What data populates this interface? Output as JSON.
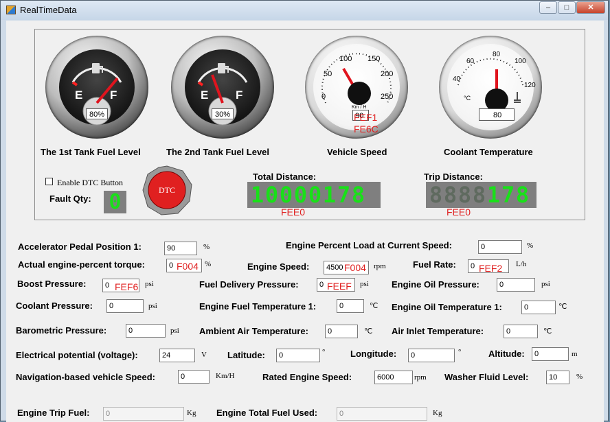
{
  "window": {
    "title": "RealTimeData"
  },
  "caption": {
    "minimize": "‒",
    "maximize": "□",
    "close": "✕"
  },
  "gauges": {
    "tank1": {
      "label": "The 1st Tank Fuel Level",
      "value": "80%",
      "level": 0.8,
      "e": "E",
      "f": "F"
    },
    "tank2": {
      "label": "The 2nd Tank Fuel Level",
      "value": "30%",
      "level": 0.3,
      "e": "E",
      "f": "F"
    },
    "speed": {
      "label": "Vehicle Speed",
      "value": "90",
      "unit": "Km / H",
      "pgn1": "FEF1",
      "pgn2": "FE6C",
      "ticks": [
        "0",
        "50",
        "100",
        "150",
        "200",
        "250"
      ]
    },
    "coolant": {
      "label": "Coolant Temperature",
      "value": "80",
      "unit": "°C",
      "ticks": [
        "40",
        "60",
        "80",
        "100",
        "120"
      ]
    }
  },
  "dtc": {
    "checkbox_label": "Enable DTC Button",
    "fault_label": "Fault Qty:",
    "fault_value": "0",
    "button_label": "DTC"
  },
  "total_distance": {
    "label": "Total Distance:",
    "digits": [
      "1",
      "0",
      "0",
      "0",
      "0",
      "1",
      "7",
      "8"
    ],
    "lit": 8,
    "pgn": "FEE0"
  },
  "trip_distance": {
    "label": "Trip Distance:",
    "digits": [
      "8",
      "8",
      "8",
      "8",
      "1",
      "7",
      "8"
    ],
    "lit": 3,
    "pgn": "FEE0"
  },
  "fields": {
    "accel": {
      "label": "Accelerator Pedal Position 1:",
      "value": "90",
      "unit": "%"
    },
    "load": {
      "label": "Engine Percent Load at Current Speed:",
      "value": "0",
      "unit": "%"
    },
    "torque": {
      "label": "Actual engine-percent torque:",
      "value": "0",
      "pgn": "F004",
      "unit": "%"
    },
    "enginespeed": {
      "label": "Engine Speed:",
      "value": "4500",
      "pgn": "F004",
      "unit": "rpm"
    },
    "fuelrate": {
      "label": "Fuel Rate:",
      "value": "0",
      "pgn": "FEF2",
      "unit": "L/h"
    },
    "boost": {
      "label": "Boost Pressure:",
      "value": "0",
      "pgn": "FEF6",
      "unit": "psi"
    },
    "fueldelivery": {
      "label": "Fuel Delivery Pressure:",
      "value": "0",
      "pgn": "FEEF",
      "unit": "psi"
    },
    "oilpressure": {
      "label": "Engine Oil Pressure:",
      "value": "0",
      "unit": "psi"
    },
    "coolantpressure": {
      "label": "Coolant Pressure:",
      "value": "0",
      "unit": "psi"
    },
    "fueltemp": {
      "label": "Engine Fuel Temperature 1:",
      "value": "0",
      "unit": "℃"
    },
    "oiltemp": {
      "label": "Engine Oil Temperature 1:",
      "value": "0",
      "unit": "℃"
    },
    "baro": {
      "label": "Barometric Pressure:",
      "value": "0",
      "unit": "psi"
    },
    "ambient": {
      "label": "Ambient Air Temperature:",
      "value": "0",
      "unit": "℃"
    },
    "airinlet": {
      "label": "Air Inlet Temperature:",
      "value": "0",
      "unit": "℃"
    },
    "voltage": {
      "label": "Electrical potential (voltage):",
      "value": "24",
      "unit": "V"
    },
    "latitude": {
      "label": "Latitude:",
      "value": "0",
      "unit": "°"
    },
    "longitude": {
      "label": "Longitude:",
      "value": "0",
      "unit": "°"
    },
    "altitude": {
      "label": "Altitude:",
      "value": "0",
      "unit": "m"
    },
    "navspeed": {
      "label": "Navigation-based vehicle Speed:",
      "value": "0",
      "unit": "Km/H"
    },
    "rated": {
      "label": "Rated Engine Speed:",
      "value": "6000",
      "unit": "rpm"
    },
    "washer": {
      "label": "Washer Fluid Level:",
      "value": "10",
      "unit": "%"
    },
    "tripfuel": {
      "label": "Engine Trip Fuel:",
      "value": "0",
      "unit": "Kg"
    },
    "totalfuel": {
      "label": "Engine Total Fuel Used:",
      "value": "0",
      "unit": "Kg"
    }
  },
  "colors": {
    "pgn": "#e02020",
    "needle": "#e0141e",
    "lcd_on": "#19e019",
    "lcd_off": "#5f6a5f",
    "lcd_bg": "#7f7f7f"
  }
}
